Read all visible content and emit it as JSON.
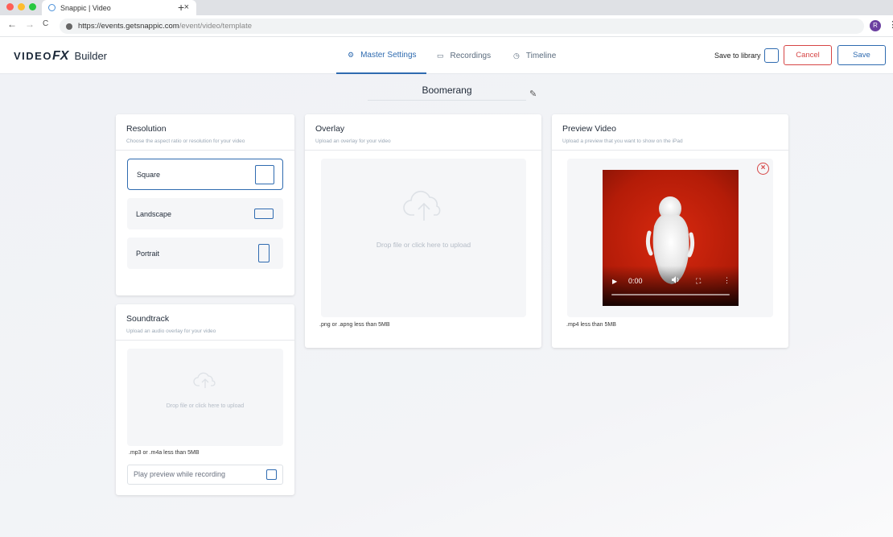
{
  "browser": {
    "tab_title": "Snappic | Video",
    "tab_close": "×",
    "new_tab": "+",
    "url_host": "https://events.getsnappic.com",
    "url_path": "/event/video/template",
    "profile_initial": "R",
    "nav_back": "←",
    "nav_forward": "→",
    "nav_reload": "C",
    "menu": "⋮",
    "traffic_colors": [
      "#ff5f57",
      "#febc2e",
      "#28c840"
    ]
  },
  "header": {
    "logo_prefix": "VIDEO",
    "logo_fx": "FX",
    "logo_suffix": "Builder",
    "tabs": [
      {
        "label": "Master Settings",
        "icon": "gear-icon",
        "glyph": "⚙"
      },
      {
        "label": "Recordings",
        "icon": "camera-icon",
        "glyph": "▭"
      },
      {
        "label": "Timeline",
        "icon": "clock-icon",
        "glyph": "◷"
      }
    ],
    "active_tab": "Master Settings",
    "save_to_library_label": "Save to library",
    "cancel_label": "Cancel",
    "save_label": "Save"
  },
  "template": {
    "name": "Boomerang",
    "edit_glyph": "✎"
  },
  "resolution": {
    "title": "Resolution",
    "subtitle": "Choose the aspect ratio or resolution for your video",
    "options": [
      {
        "label": "Square",
        "selected": true
      },
      {
        "label": "Landscape",
        "selected": false
      },
      {
        "label": "Portrait",
        "selected": false
      }
    ]
  },
  "soundtrack": {
    "title": "Soundtrack",
    "subtitle": "Upload an audio overlay for your video",
    "drop_text": "Drop file or click here to upload",
    "note": ".mp3 or .m4a less than 5MB",
    "preview_label": "Play preview while recording",
    "preview_checked": false
  },
  "overlay": {
    "title": "Overlay",
    "subtitle": "Upload an overlay for your video",
    "drop_text": "Drop file or click here to upload",
    "note": ".png or .apng less than 5MB"
  },
  "preview_video": {
    "title": "Preview Video",
    "subtitle": "Upload a preview that you want to show on the iPad",
    "time": "0:00",
    "note": ".mp4 less than 5MB",
    "remove_glyph": "×",
    "play_glyph": "▶",
    "fullscreen_glyph": "⛶",
    "more_glyph": "⋮",
    "video_color": "#c8230b"
  },
  "colors": {
    "accent": "#2f6bb0",
    "danger": "#d64545"
  }
}
